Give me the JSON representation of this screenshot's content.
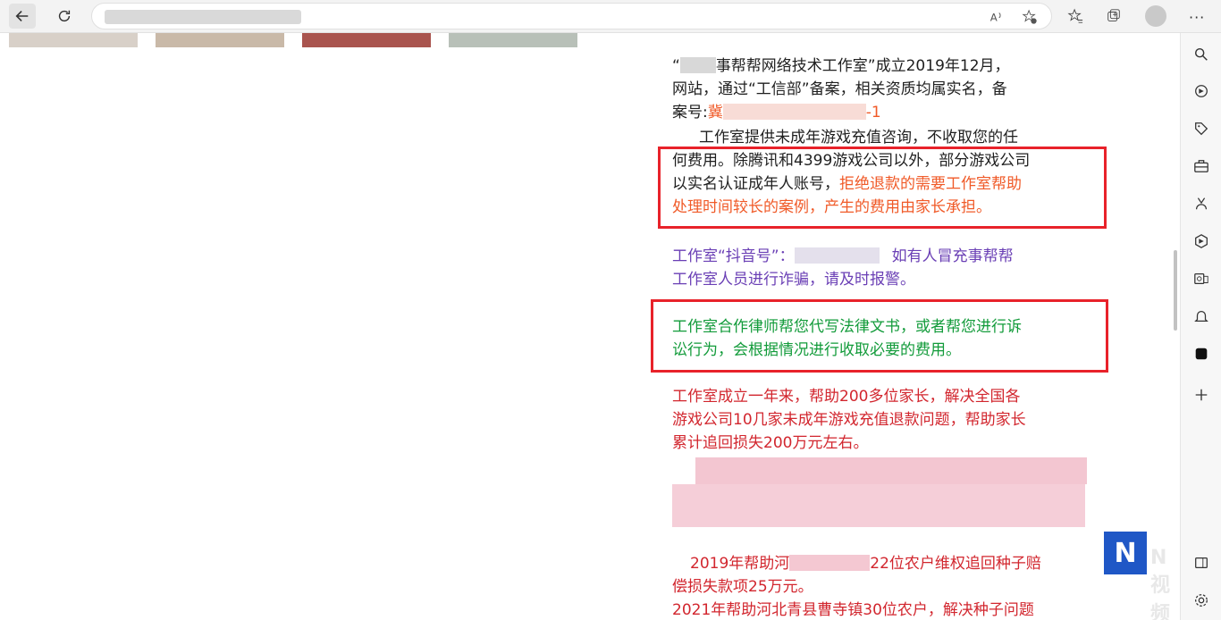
{
  "article": {
    "p1_a": "“",
    "p1_b": "事帮帮网络技术工作室”成立2019年12月，",
    "p1_c": "网站，通过“工信部”备案，相关资质均属实名，备",
    "p1_d": "案号:",
    "p1_e": "冀",
    "p1_f": "-1",
    "p2_a": "工作室提供未成年游戏充值咨询，不收取您的任",
    "p2_b": "何费用。除腾讯和4399游戏公司以外，部分游戏公司",
    "p2_c": "以实名认证成年人账号，",
    "p2_d": "拒绝退款的需要工作室帮助",
    "p2_e": "处理时间较长的案例，产生的费用由家长承担。",
    "p3_a": "工作室“抖音号”：",
    "p3_b": "如有人冒充事帮帮",
    "p3_c": "工作室人员进行诈骗，请及时报警。",
    "p4_a": "工作室合作律师帮您代写法律文书，或者帮您进行诉",
    "p4_b": "讼行为，会根据情况进行收取必要的费用。",
    "p5_a": "工作室成立一年来，帮助200多位家长，解决全国各",
    "p5_b": "游戏公司10几家未成年游戏充值退款问题，帮助家长",
    "p5_c": "累计追回损失200万元左右。",
    "p6_a": "2019年帮助河",
    "p6_b": "22位农户维权追回种子赔",
    "p6_c": "偿损失款项25万元。",
    "p7_a": "2021年帮助河北青县曹寺镇30位农户，解决种子问题"
  },
  "watermark": {
    "logo_letter": "N",
    "text": "N视频"
  },
  "icons": {
    "toolbar": [
      "back-arrow-icon",
      "refresh-icon",
      "read-aloud-icon",
      "add-favorite-icon",
      "favorites-icon",
      "collections-icon",
      "profile-icon",
      "more-icon"
    ],
    "sidebar": [
      "search-icon",
      "discover-icon",
      "tag-icon",
      "toolbox-icon",
      "games-icon",
      "copilot-icon",
      "outlook-icon",
      "bell-icon",
      "app-icon",
      "add-icon",
      "sidebar-panel-icon",
      "settings-icon"
    ]
  },
  "colors": {
    "orange": "#f05a28",
    "purple": "#6a3fb5",
    "green": "#129b3a",
    "red": "#d2262e",
    "box": "#e8222a"
  }
}
